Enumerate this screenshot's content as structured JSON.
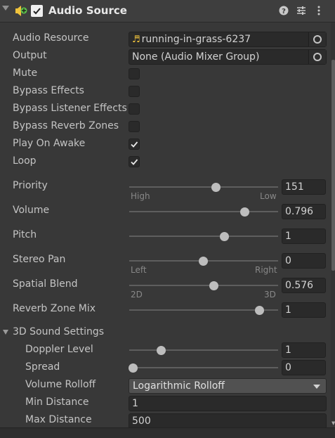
{
  "component": {
    "title": "Audio Source",
    "enabled": true
  },
  "fields": {
    "audio_resource": {
      "label": "Audio Resource",
      "value": "running-in-grass-6237",
      "icon": "audio-clip-icon"
    },
    "output": {
      "label": "Output",
      "value": "None (Audio Mixer Group)"
    },
    "mute": {
      "label": "Mute",
      "checked": false
    },
    "bypass_effects": {
      "label": "Bypass Effects",
      "checked": false
    },
    "bypass_listener_effects": {
      "label": "Bypass Listener Effects",
      "checked": false
    },
    "bypass_reverb_zones": {
      "label": "Bypass Reverb Zones",
      "checked": false
    },
    "play_on_awake": {
      "label": "Play On Awake",
      "checked": true
    },
    "loop": {
      "label": "Loop",
      "checked": true
    }
  },
  "sliders": {
    "priority": {
      "label": "Priority",
      "value": "151",
      "fraction": 0.59,
      "left_tick": "High",
      "right_tick": "Low"
    },
    "volume": {
      "label": "Volume",
      "value": "0.796",
      "fraction": 0.796
    },
    "pitch": {
      "label": "Pitch",
      "value": "1",
      "fraction": 0.65
    },
    "stereo_pan": {
      "label": "Stereo Pan",
      "value": "0",
      "fraction": 0.5,
      "left_tick": "Left",
      "right_tick": "Right"
    },
    "spatial_blend": {
      "label": "Spatial Blend",
      "value": "0.576",
      "fraction": 0.576,
      "left_tick": "2D",
      "right_tick": "3D"
    },
    "reverb_zone_mix": {
      "label": "Reverb Zone Mix",
      "value": "1",
      "fraction": 0.9
    }
  },
  "sound3d": {
    "header": "3D Sound Settings",
    "doppler_level": {
      "label": "Doppler Level",
      "value": "1",
      "fraction": 0.2
    },
    "spread": {
      "label": "Spread",
      "value": "0",
      "fraction": 0.0
    },
    "volume_rolloff": {
      "label": "Volume Rolloff",
      "value": "Logarithmic Rolloff"
    },
    "min_distance": {
      "label": "Min Distance",
      "value": "1"
    },
    "max_distance": {
      "label": "Max Distance",
      "value": "500"
    }
  },
  "colors": {
    "background": "#383838",
    "header": "#3e3e3e",
    "field": "#2a2a2a",
    "text": "#c4c4c4",
    "audio_icon": "#f0c33c",
    "plus_badge": "#5cc24a"
  }
}
